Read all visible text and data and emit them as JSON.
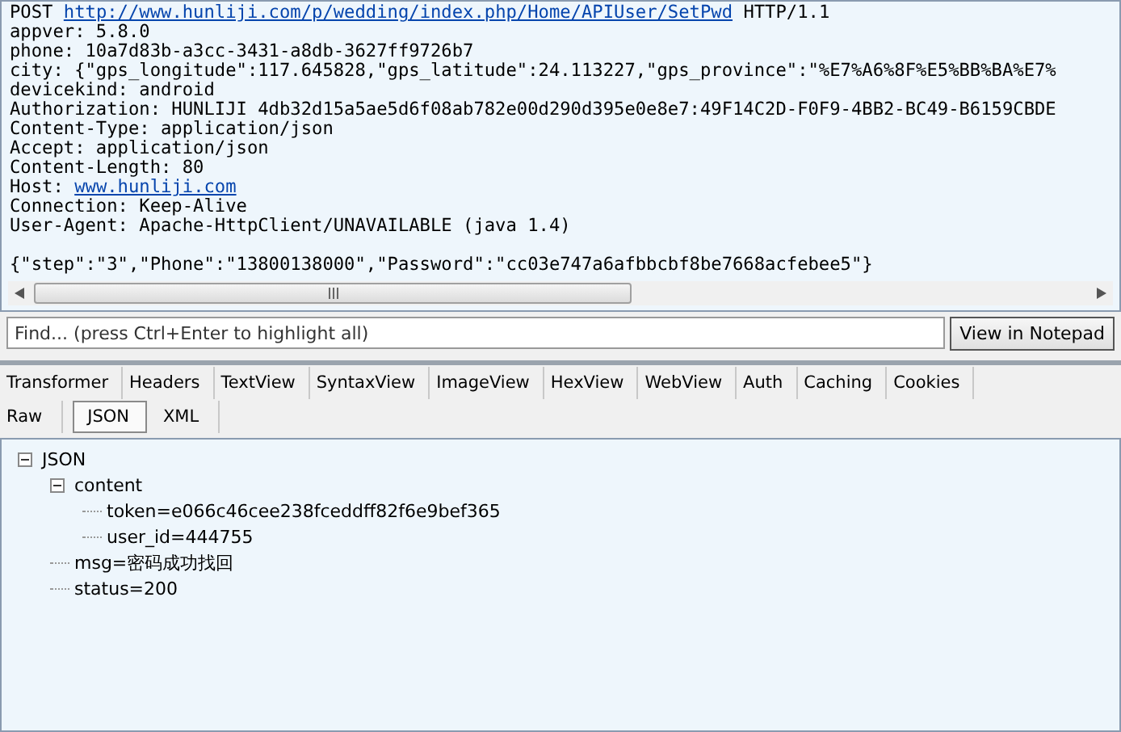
{
  "request": {
    "method": "POST",
    "url": "http://www.hunliji.com/p/wedding/index.php/Home/APIUser/SetPwd",
    "version": "HTTP/1.1",
    "headers": [
      {
        "text": "appver: 5.8.0"
      },
      {
        "text": "phone: 10a7d83b-a3cc-3431-a8db-3627ff9726b7"
      },
      {
        "text": "city: {\"gps_longitude\":117.645828,\"gps_latitude\":24.113227,\"gps_province\":\"%E7%A6%8F%E5%BB%BA%E7%"
      },
      {
        "text": "devicekind: android"
      },
      {
        "text": "Authorization: HUNLIJI 4db32d15a5ae5d6f08ab782e00d290d395e0e8e7:49F14C2D-F0F9-4BB2-BC49-B6159CBDE"
      },
      {
        "text": "Content-Type: application/json"
      },
      {
        "text": "Accept: application/json"
      },
      {
        "text": "Content-Length: 80"
      },
      {
        "name": "Host:",
        "link": "www.hunliji.com"
      },
      {
        "text": "Connection: Keep-Alive"
      },
      {
        "text": "User-Agent: Apache-HttpClient/UNAVAILABLE (java 1.4)"
      }
    ],
    "body": "{\"step\":\"3\",\"Phone\":\"13800138000\",\"Password\":\"cc03e747a6afbbcbf8be7668acfebee5\"}"
  },
  "find": {
    "placeholder": "Find... (press Ctrl+Enter to highlight all)",
    "button": "View in Notepad"
  },
  "tabs": [
    {
      "label": "Transformer",
      "selected": false
    },
    {
      "label": "Headers",
      "selected": false
    },
    {
      "label": "TextView",
      "selected": false
    },
    {
      "label": "SyntaxView",
      "selected": false
    },
    {
      "label": "ImageView",
      "selected": false
    },
    {
      "label": "HexView",
      "selected": false
    },
    {
      "label": "WebView",
      "selected": false
    },
    {
      "label": "Auth",
      "selected": false
    },
    {
      "label": "Caching",
      "selected": false
    },
    {
      "label": "Cookies",
      "selected": false
    }
  ],
  "subtabs": [
    {
      "label": "Raw",
      "selected": false
    },
    {
      "label": "JSON",
      "selected": true
    },
    {
      "label": "XML",
      "selected": false
    }
  ],
  "tree": [
    {
      "label": "JSON",
      "expanded": true,
      "children": [
        {
          "label": "content",
          "expanded": true,
          "children": [
            {
              "label": "token=e066c46cee238fceddff82f6e9bef365"
            },
            {
              "label": "user_id=444755"
            }
          ]
        },
        {
          "label": "msg=密码成功找回"
        },
        {
          "label": "status=200"
        }
      ]
    }
  ]
}
